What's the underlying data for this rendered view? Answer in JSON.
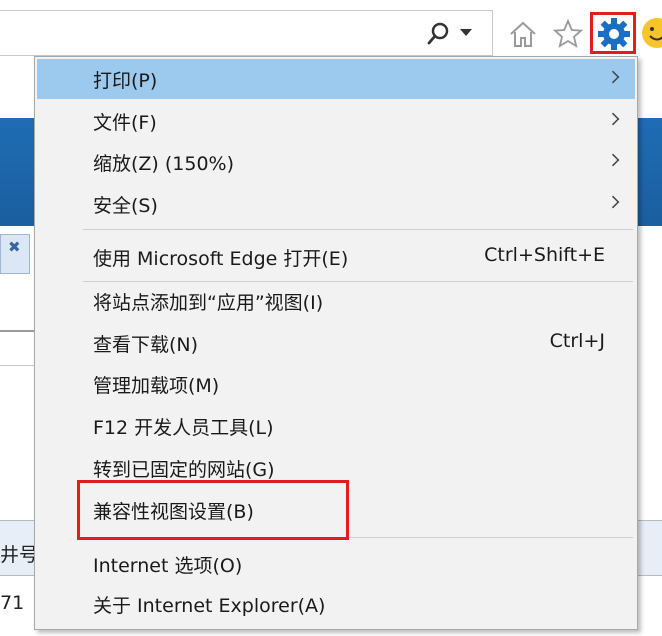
{
  "toolbar": {
    "icons": [
      "search-icon",
      "dropdown-arrow",
      "home-icon",
      "favorites-icon",
      "gear-icon",
      "smiley-icon"
    ],
    "tools_highlight_color": "#e11d1d"
  },
  "background": {
    "row_text_1": "井号",
    "row_text_2": "71"
  },
  "menu": {
    "items": [
      {
        "label": "打印(P)",
        "submenu": true
      },
      {
        "label": "文件(F)",
        "submenu": true
      },
      {
        "label": "缩放(Z) (150%)",
        "submenu": true
      },
      {
        "label": "安全(S)",
        "submenu": true
      },
      {
        "label": "使用 Microsoft Edge 打开(E)",
        "shortcut": "Ctrl+Shift+E"
      },
      {
        "label": "将站点添加到“应用”视图(I)"
      },
      {
        "label": "查看下载(N)",
        "shortcut": "Ctrl+J"
      },
      {
        "label": "管理加载项(M)"
      },
      {
        "label": "F12 开发人员工具(L)"
      },
      {
        "label": "转到已固定的网站(G)"
      },
      {
        "label": "兼容性视图设置(B)"
      },
      {
        "label": "Internet 选项(O)"
      },
      {
        "label": "关于 Internet Explorer(A)"
      }
    ],
    "hover_color": "#9ccaef",
    "highlight_box_color": "#e11d1d"
  }
}
